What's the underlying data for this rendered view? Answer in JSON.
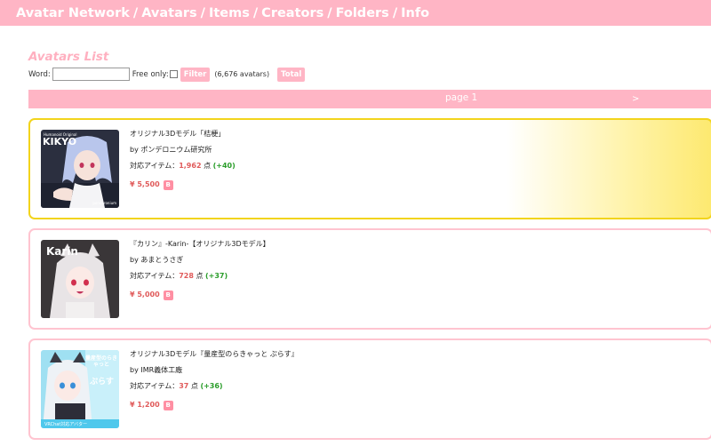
{
  "nav": {
    "items": [
      "Avatar Network",
      "Avatars",
      "Items",
      "Creators",
      "Folders",
      "Info"
    ],
    "separator": "/"
  },
  "list_title": "Avatars List",
  "search": {
    "word_label": "Word:",
    "word_value": "",
    "free_only_label": "Free only:",
    "free_only_checked": false,
    "filter_button": "Filter",
    "count_text": "(6,676 avatars)",
    "total_button": "Total"
  },
  "pager": {
    "label": "page 1",
    "next": ">"
  },
  "avatars": [
    {
      "title": "オリジナル3Dモデル「桔梗」",
      "creator": "by ポンデロニウム研究所",
      "items_label": "対応アイテム：",
      "items_count": "1,962",
      "items_unit": "点",
      "items_delta": "(+40)",
      "price": "¥ 5,500",
      "badge": "B",
      "thumb_text": "KIKYO",
      "thumb_sub": "Humanoid Original",
      "thumb_caption": "ponderonium",
      "featured": true
    },
    {
      "title": "『カリン』-Karin-【オリジナル3Dモデル】",
      "creator": "by あまとうさぎ",
      "items_label": "対応アイテム：",
      "items_count": "728",
      "items_unit": "点",
      "items_delta": "(+37)",
      "price": "¥ 5,000",
      "badge": "B",
      "thumb_text": "Karin",
      "thumb_sub": "",
      "thumb_caption": "",
      "featured": false
    },
    {
      "title": "オリジナル3Dモデル『量産型のらきゃっと ぷらす』",
      "creator": "by IMR義体工廠",
      "items_label": "対応アイテム：",
      "items_count": "37",
      "items_unit": "点",
      "items_delta": "(+36)",
      "price": "¥ 1,200",
      "badge": "B",
      "thumb_text": "ぷらす",
      "thumb_sub": "量産型のらきゃっと",
      "thumb_caption": "VRChat対応アバター",
      "featured": false
    }
  ],
  "colors": {
    "header_pink": "#ffb5c5",
    "title_pink": "#ffb0c0",
    "featured_border": "#f2d41c",
    "card_border": "#ffc4d0",
    "price_red": "#e05a5a",
    "delta_green": "#2a9d2a"
  }
}
